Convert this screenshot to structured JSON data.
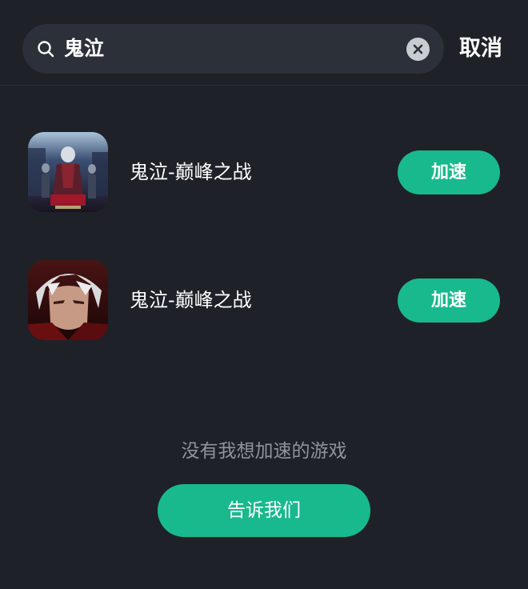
{
  "search": {
    "query": "鬼泣",
    "cancel_label": "取消"
  },
  "results": [
    {
      "title": "鬼泣-巅峰之战",
      "button_label": "加速"
    },
    {
      "title": "鬼泣-巅峰之战",
      "button_label": "加速"
    }
  ],
  "footer": {
    "no_game_text": "没有我想加速的游戏",
    "tell_us_label": "告诉我们"
  },
  "colors": {
    "background": "#1e2128",
    "search_box": "#2c3039",
    "accent_green": "#18b98d",
    "muted_text": "#8f939b"
  },
  "icons": {
    "search": "search-icon",
    "clear": "clear-icon"
  }
}
